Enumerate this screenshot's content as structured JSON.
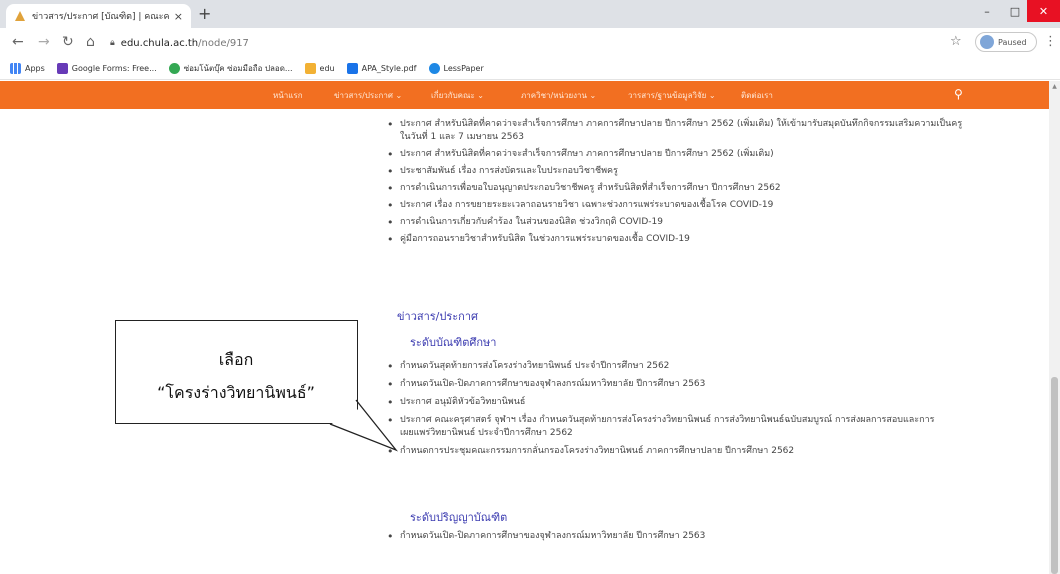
{
  "browser": {
    "tab_title": "ข่าวสาร/ประกาศ [บัณฑิต] | คณะครุศาสตร์",
    "tab_close": "×",
    "new_tab": "+",
    "url_host": "edu.chula.ac.th",
    "url_path": "/node/917",
    "profile_status": "Paused",
    "win_min": "–",
    "win_max": "□",
    "win_close": "✕"
  },
  "bookmarks": [
    {
      "label": "Apps",
      "color": "#4285f4"
    },
    {
      "label": "Google Forms: Free...",
      "color": "#673ab7"
    },
    {
      "label": "ซ่อมโน้ตบุ๊ค ซ่อมมือถือ ปลอด...",
      "color": "#34a853"
    },
    {
      "label": "edu",
      "color": "#f26f21"
    },
    {
      "label": "APA_Style.pdf",
      "color": "#1a73e8"
    },
    {
      "label": "LessPaper",
      "color": "#1e88e5"
    }
  ],
  "site_nav": [
    {
      "label": "หน้าแรก"
    },
    {
      "label": "ข่าวสาร/ประกาศ ⌄"
    },
    {
      "label": "เกี่ยวกับคณะ ⌄"
    },
    {
      "label": "ภาควิชา/หน่วยงาน ⌄"
    },
    {
      "label": "วารสาร/ฐานข้อมูลวิจัย ⌄"
    },
    {
      "label": "ติดต่อเรา"
    }
  ],
  "announcements_top": [
    "ประกาศ สำหรับนิสิตที่คาดว่าจะสำเร็จการศึกษา ภาคการศึกษาปลาย ปีการศึกษา 2562 (เพิ่มเติม) ให้เข้ามารับสมุดบันทึกกิจกรรมเสริมความเป็นครู ในวันที่ 1 และ 7 เมษายน 2563",
    "ประกาศ สำหรับนิสิตที่คาดว่าจะสำเร็จการศึกษา ภาคการศึกษาปลาย ปีการศึกษา 2562 (เพิ่มเติม)",
    "ประชาสัมพันธ์ เรื่อง การส่งบัตรและใบประกอบวิชาชีพครู",
    "การดำเนินการเพื่อขอใบอนุญาตประกอบวิชาชีพครู สำหรับนิสิตที่สำเร็จการศึกษา ปีการศึกษา 2562",
    "ประกาศ เรื่อง การขยายระยะเวลาถอนรายวิชา เฉพาะช่วงการแพร่ระบาดของเชื้อโรค COVID-19",
    "การดำเนินการเกี่ยวกับคำร้อง ในส่วนของนิสิต ช่วงวิกฤติ COVID-19",
    "คู่มือการถอนรายวิชาสำหรับนิสิต ในช่วงการแพร่ระบาดของเชื้อ COVID-19"
  ],
  "section_title": "ข่าวสาร/ประกาศ",
  "graduate": {
    "title": "ระดับบัณฑิตศึกษา",
    "items": [
      "กำหนดวันสุดท้ายการส่งโครงร่างวิทยานิพนธ์ ประจำปีการศึกษา 2562",
      "กำหนดวันเปิด-ปิดภาคการศึกษาของจุฬาลงกรณ์มหาวิทยาลัย ปีการศึกษา 2563",
      "ประกาศ อนุมัติหัวข้อวิทยานิพนธ์",
      "ประกาศ คณะครุศาสตร์ จุฬาฯ เรื่อง กำหนดวันสุดท้ายการส่งโครงร่างวิทยานิพนธ์ การส่งวิทยานิพนธ์ฉบับสมบูรณ์ การส่งผลการสอบและการเผยแพร่วิทยานิพนธ์ ประจำปีการศึกษา 2562",
      "กำหนดการประชุมคณะกรรมการกลั่นกรองโครงร่างวิทยานิพนธ์ ภาคการศึกษาปลาย ปีการศึกษา 2562"
    ]
  },
  "undergraduate": {
    "title": "ระดับปริญญาบัณฑิต",
    "items": [
      "กำหนดวันเปิด-ปิดภาคการศึกษาของจุฬาลงกรณ์มหาวิทยาลัย ปีการศึกษา 2563"
    ]
  },
  "callout": {
    "line1": "เลือก",
    "line2": "“โครงร่างวิทยานิพนธ์”"
  },
  "colors": {
    "nav_orange": "#f26f21",
    "link_blue": "#3b3bb0"
  }
}
